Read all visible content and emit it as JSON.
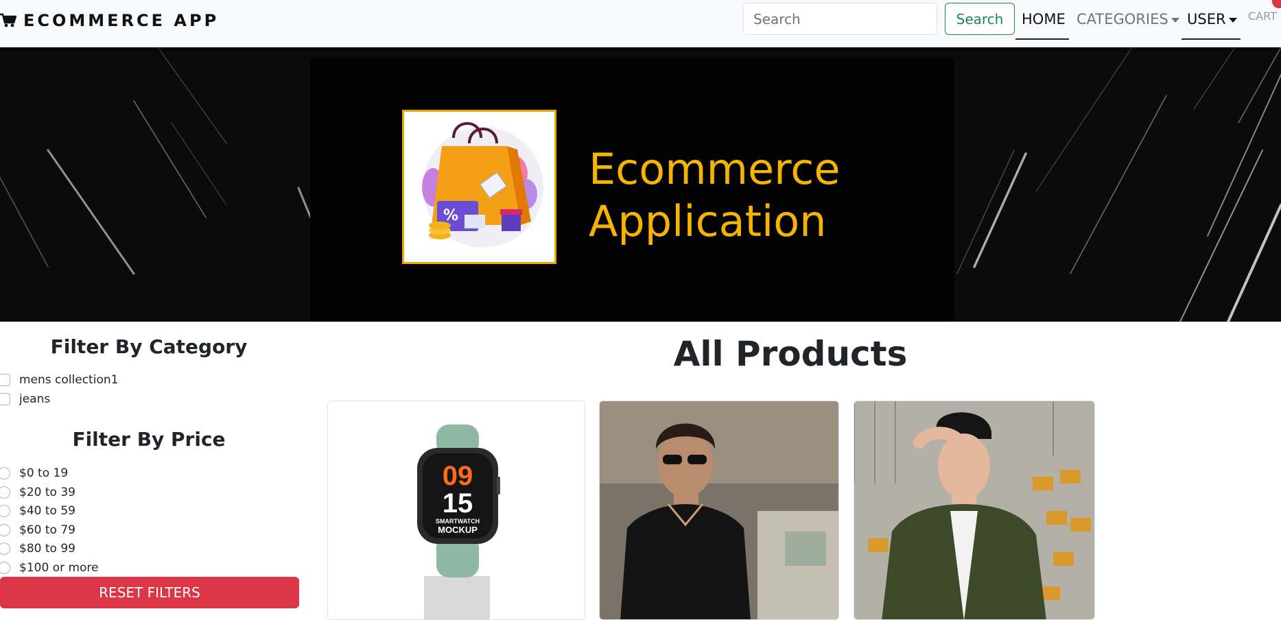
{
  "navbar": {
    "brand": "ECOMMERCE APP",
    "search_placeholder": "Search",
    "search_button": "Search",
    "links": {
      "home": "HOME",
      "categories": "CATEGORIES",
      "user": "USER",
      "cart": "CART"
    },
    "icons": [
      "cart-icon",
      "caret-down-icon"
    ]
  },
  "banner": {
    "title_line1": "Ecommerce",
    "title_line2": "Application"
  },
  "sidebar": {
    "category_heading": "Filter By Category",
    "categories": [
      "mens collection1",
      "jeans"
    ],
    "price_heading": "Filter By Price",
    "prices": [
      "$0 to 19",
      "$20 to 39",
      "$40 to 59",
      "$60 to 79",
      "$80 to 99",
      "$100 or more"
    ],
    "reset_button": "RESET FILTERS"
  },
  "products": {
    "heading": "All Products",
    "watch_text": {
      "hour": "09",
      "minute": "15",
      "line1": "SMARTWATCH",
      "line2": "MOCKUP"
    }
  },
  "colors": {
    "accent_green": "#198754",
    "danger_red": "#dc3545",
    "banner_gold": "#f4b400"
  }
}
